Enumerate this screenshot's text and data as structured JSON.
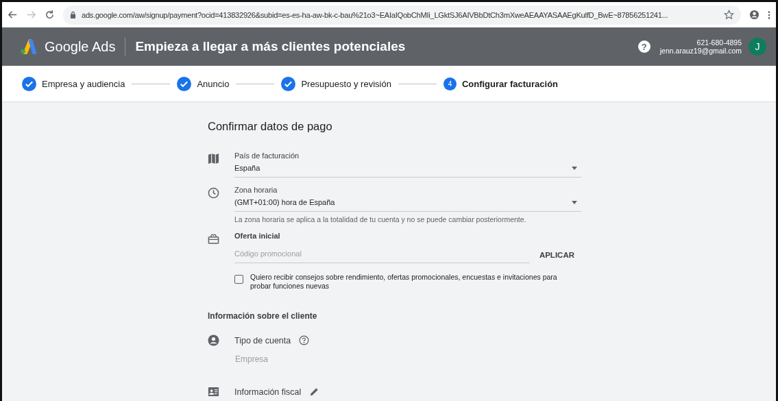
{
  "browser": {
    "url": "ads.google.com/aw/signup/payment?ocid=413832926&subid=es-es-ha-aw-bk-c-bau%21o3~EAIaIQobChMIi_LGktSJ6AIVBbDtCh3mXweAEAAYASAAEgKulfD_BwE~87856251241..."
  },
  "header": {
    "product": "Google Ads",
    "title": "Empieza a llegar a más clientes potenciales",
    "help": "?",
    "phone": "621-680-4895",
    "email": "jenn.arauz19@gmail.com",
    "avatar": "J"
  },
  "steps": [
    {
      "label": "Empresa y audiencia",
      "done": true,
      "selected": false
    },
    {
      "label": "Anuncio",
      "done": true,
      "selected": false
    },
    {
      "label": "Presupuesto y revisión",
      "done": true,
      "selected": false
    },
    {
      "label": "Configurar facturación",
      "number": "4",
      "done": false,
      "selected": true
    }
  ],
  "form": {
    "title": "Confirmar datos de pago",
    "country": {
      "label": "País de facturación",
      "value": "España"
    },
    "timezone": {
      "label": "Zona horaria",
      "value": "(GMT+01:00) hora de España",
      "hint": "La zona horaria se aplica a la totalidad de tu cuenta y no se puede cambiar posteriormente."
    },
    "offer": {
      "label": "Oferta inicial",
      "placeholder": "Código promocional",
      "button": "APLICAR"
    },
    "consent": {
      "label": "Quiero recibir consejos sobre rendimiento, ofertas promocionales, encuestas e invitaciones para probar funciones nuevas",
      "checked": false
    }
  },
  "customer": {
    "title": "Información sobre el cliente",
    "account_type": {
      "label": "Tipo de cuenta",
      "value": "Empresa"
    },
    "tax_info": {
      "label": "Información fiscal"
    }
  }
}
